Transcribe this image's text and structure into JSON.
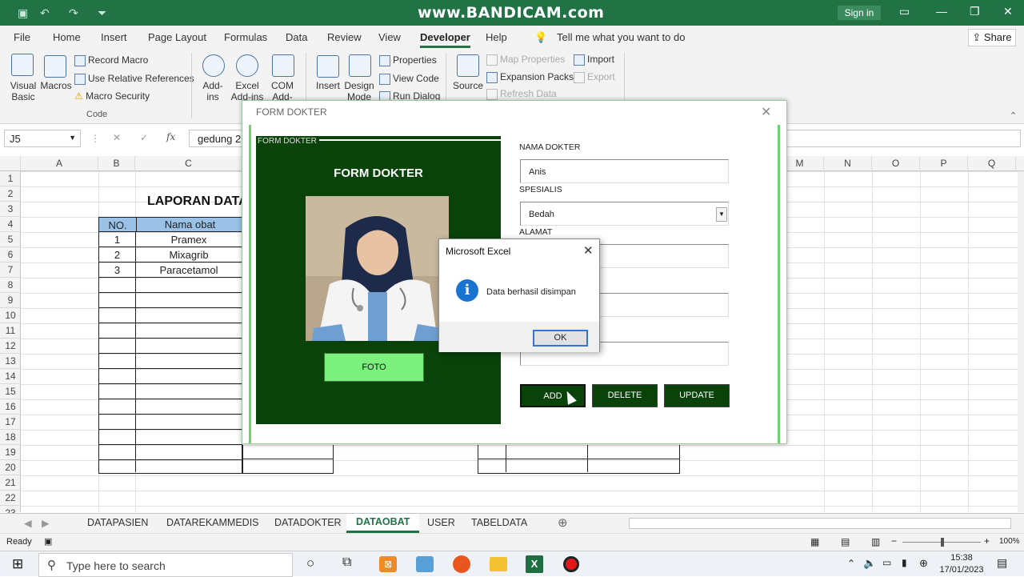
{
  "titlebar": {
    "watermark": "www.BANDICAM.com",
    "signin": "Sign in"
  },
  "menu": {
    "tabs": [
      "File",
      "Home",
      "Insert",
      "Page Layout",
      "Formulas",
      "Data",
      "Review",
      "View",
      "Developer",
      "Help"
    ],
    "active": "Developer",
    "tell_me": "Tell me what you want to do",
    "share": "Share"
  },
  "ribbon": {
    "visual_basic": "Visual Basic",
    "macros": "Macros",
    "record_macro": "Record Macro",
    "use_relative": "Use Relative References",
    "macro_security": "Macro Security",
    "code_group": "Code",
    "add_ins": "Add-ins",
    "excel_add_ins": "Excel Add-ins",
    "com_add_ins": "COM Add-ins",
    "insert": "Insert",
    "design_mode": "Design Mode",
    "properties": "Properties",
    "view_code": "View Code",
    "run_dialog": "Run Dialog",
    "source": "Source",
    "map_properties": "Map Properties",
    "expansion_packs": "Expansion Packs",
    "refresh_data": "Refresh Data",
    "import": "Import",
    "export": "Export"
  },
  "formula_bar": {
    "name_box": "J5",
    "content": "gedung 2"
  },
  "grid": {
    "columns": [
      "A",
      "B",
      "C",
      "M",
      "N",
      "O",
      "P",
      "Q"
    ],
    "rows": [
      "1",
      "2",
      "3",
      "4",
      "5",
      "6",
      "7",
      "8",
      "9",
      "10",
      "11",
      "12",
      "13",
      "14",
      "15",
      "16",
      "17",
      "18",
      "19",
      "20",
      "21",
      "22",
      "23"
    ],
    "report_title": "LAPORAN DATA",
    "table_headers": [
      "NO.",
      "Nama obat"
    ],
    "table_rows": [
      {
        "no": "1",
        "name": "Pramex"
      },
      {
        "no": "2",
        "name": "Mixagrib"
      },
      {
        "no": "3",
        "name": "Paracetamol"
      }
    ]
  },
  "sheets": {
    "tabs": [
      "DATAPASIEN",
      "DATAREKAMMEDIS",
      "DATADOKTER",
      "DATAOBAT",
      "USER",
      "TABELDATA"
    ],
    "active": "DATAOBAT"
  },
  "status": {
    "ready": "Ready",
    "zoom": "100%"
  },
  "taskbar": {
    "search_placeholder": "Type here to search",
    "time": "15:38",
    "date": "17/01/2023"
  },
  "userform": {
    "title": "FORM DOKTER",
    "frame_caption": "FORM DOKTER",
    "heading": "FORM DOKTER",
    "foto_button": "FOTO",
    "labels": {
      "nama": "NAMA DOKTER",
      "spesialis": "SPESIALIS",
      "alamat": "ALAMAT"
    },
    "values": {
      "nama": "Anis",
      "spesialis": "Bedah"
    },
    "buttons": [
      "ADD",
      "DELETE",
      "UPDATE"
    ]
  },
  "msgbox": {
    "title": "Microsoft Excel",
    "message": "Data berhasil disimpan",
    "ok": "OK"
  },
  "colors": {
    "excel_green": "#217346",
    "form_dark_green": "#0a430a",
    "foto_button": "#7cf07c",
    "info_blue": "#1a73d1"
  }
}
